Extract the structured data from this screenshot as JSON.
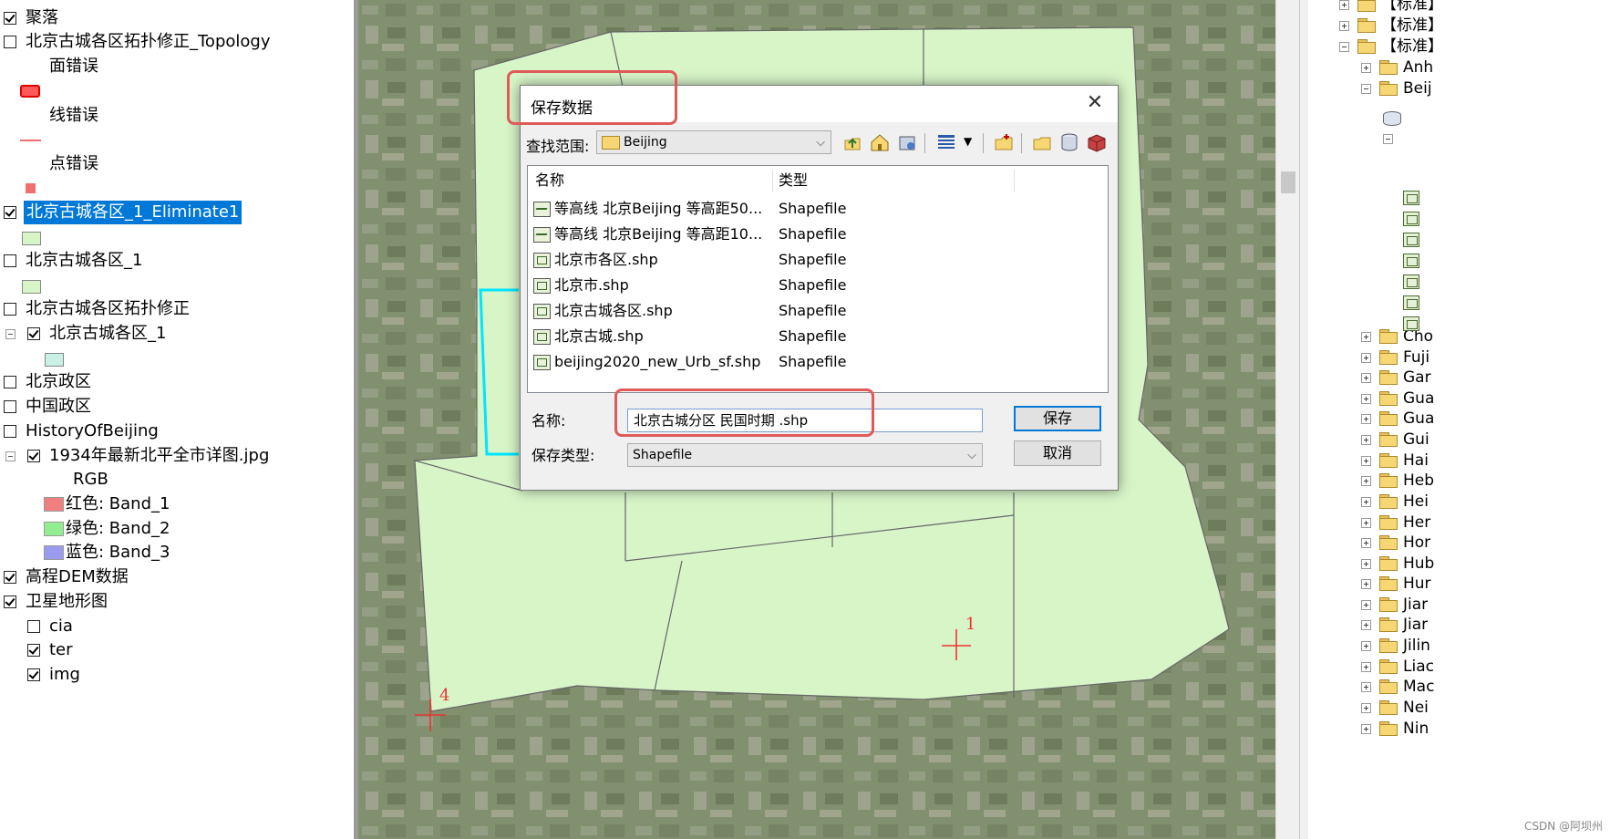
{
  "toc": {
    "items": [
      {
        "label": "聚落",
        "checked": true
      },
      {
        "label": "北京古城各区拓扑修正_Topology",
        "checked": false
      },
      {
        "label": "面错误"
      },
      {
        "label": "线错误"
      },
      {
        "label": "点错误"
      },
      {
        "label": "北京古城各区_1_Eliminate1",
        "checked": true,
        "selected": true
      },
      {
        "label": "北京古城各区_1",
        "checked": false
      },
      {
        "label": "北京古城各区拓扑修正",
        "checked": false
      },
      {
        "label": "北京古城各区_1",
        "checked": true
      },
      {
        "label": "北京政区",
        "checked": false
      },
      {
        "label": "中国政区",
        "checked": false
      },
      {
        "label": "HistoryOfBeijing",
        "checked": false
      },
      {
        "label": "1934年最新北平全市详图.jpg",
        "checked": true
      },
      {
        "label": "RGB"
      },
      {
        "label": "红色:    Band_1"
      },
      {
        "label": "绿色: Band_2"
      },
      {
        "label": "蓝色:    Band_3"
      },
      {
        "label": "高程DEM数据",
        "checked": true
      },
      {
        "label": "卫星地形图",
        "checked": true
      },
      {
        "label": "cia",
        "checked": false
      },
      {
        "label": "ter",
        "checked": true
      },
      {
        "label": "img",
        "checked": true
      }
    ]
  },
  "map": {
    "marks": [
      {
        "label": "1"
      },
      {
        "label": "4"
      }
    ]
  },
  "dialog": {
    "title": "保存数据",
    "look_in_label": "查找范围:",
    "look_in_value": "Beijing",
    "columns": {
      "name": "名称",
      "type": "类型"
    },
    "files": [
      {
        "name": "等高线 北京Beijing 等高距50...",
        "type": "Shapefile",
        "icon": "line"
      },
      {
        "name": "等高线 北京Beijing 等高距10...",
        "type": "Shapefile",
        "icon": "line"
      },
      {
        "name": "北京市各区.shp",
        "type": "Shapefile",
        "icon": "poly"
      },
      {
        "name": "北京市.shp",
        "type": "Shapefile",
        "icon": "poly"
      },
      {
        "name": "北京古城各区.shp",
        "type": "Shapefile",
        "icon": "poly"
      },
      {
        "name": "北京古城.shp",
        "type": "Shapefile",
        "icon": "poly"
      },
      {
        "name": "beijing2020_new_Urb_sf.shp",
        "type": "Shapefile",
        "icon": "poly"
      }
    ],
    "name_label": "名称:",
    "name_value": "北京古城分区 民国时期  .shp",
    "save_type_label": "保存类型:",
    "save_type_value": "Shapefile",
    "save_button": "保存",
    "cancel_button": "取消",
    "close_glyph": "✕"
  },
  "catalog": {
    "items": [
      {
        "label": "【标准】",
        "expander": "plus",
        "indent": 0
      },
      {
        "label": "【标准】",
        "expander": "plus",
        "indent": 0
      },
      {
        "label": "【标准】",
        "expander": "minus",
        "indent": 0
      },
      {
        "label": "Anh",
        "expander": "plus",
        "indent": 1
      },
      {
        "label": "Beij",
        "expander": "minus",
        "indent": 1
      },
      {
        "label": "Cho",
        "expander": "plus",
        "indent": 1
      },
      {
        "label": "Fuji",
        "expander": "plus",
        "indent": 1
      },
      {
        "label": "Gar",
        "expander": "plus",
        "indent": 1
      },
      {
        "label": "Gua",
        "expander": "plus",
        "indent": 1
      },
      {
        "label": "Gua",
        "expander": "plus",
        "indent": 1
      },
      {
        "label": "Gui",
        "expander": "plus",
        "indent": 1
      },
      {
        "label": "Hai",
        "expander": "plus",
        "indent": 1
      },
      {
        "label": "Heb",
        "expander": "plus",
        "indent": 1
      },
      {
        "label": "Hei",
        "expander": "plus",
        "indent": 1
      },
      {
        "label": "Her",
        "expander": "plus",
        "indent": 1
      },
      {
        "label": "Hor",
        "expander": "plus",
        "indent": 1
      },
      {
        "label": "Hub",
        "expander": "plus",
        "indent": 1
      },
      {
        "label": "Hur",
        "expander": "plus",
        "indent": 1
      },
      {
        "label": "Jiar",
        "expander": "plus",
        "indent": 1
      },
      {
        "label": "Jiar",
        "expander": "plus",
        "indent": 1
      },
      {
        "label": "Jilin",
        "expander": "plus",
        "indent": 1
      },
      {
        "label": "Liac",
        "expander": "plus",
        "indent": 1
      },
      {
        "label": "Mac",
        "expander": "plus",
        "indent": 1
      },
      {
        "label": "Nei",
        "expander": "plus",
        "indent": 1
      },
      {
        "label": "Nin",
        "expander": "plus",
        "indent": 1
      }
    ],
    "watermark": "CSDN @阿坝州"
  },
  "colors": {
    "selection": "#0078d7",
    "polygon_fill": "#d8f5c8",
    "highlight": "#e05a5a",
    "cyan_edit": "#00e5ff",
    "marker_red": "#e33"
  }
}
